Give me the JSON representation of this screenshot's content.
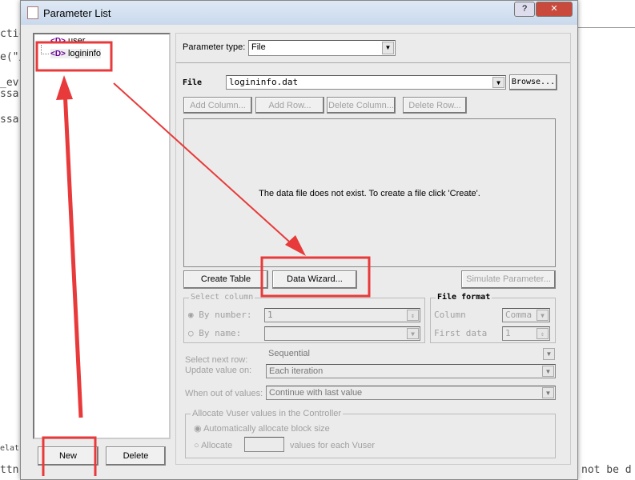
{
  "background": {
    "code": [
      "ctic",
      "e(\"/",
      "_ev",
      "ssa",
      "ssa",
      "elatio",
      "ttn"
    ],
    "right_text": "not be d"
  },
  "window": {
    "title": "Parameter List",
    "help": "?",
    "close": "✕"
  },
  "tree": {
    "items": [
      {
        "label": "user",
        "icon": "parameter-icon"
      },
      {
        "label": "logininfo",
        "icon": "parameter-icon"
      }
    ]
  },
  "left_buttons": {
    "new": "New",
    "delete": "Delete"
  },
  "param_type": {
    "label": "Parameter type:",
    "value": "File"
  },
  "file": {
    "label": "File",
    "value": "logininfo.dat",
    "browse": "Browse..."
  },
  "table_buttons": {
    "add_column": "Add Column...",
    "add_row": "Add Row...",
    "delete_column": "Delete Column...",
    "delete_row": "Delete Row..."
  },
  "message": "The data file does not exist. To create a file click 'Create'.",
  "actions": {
    "create_table": "Create Table",
    "data_wizard": "Data Wizard...",
    "simulate": "Simulate Parameter..."
  },
  "select_column": {
    "title": "Select column",
    "by_number": "By number:",
    "by_number_value": "1",
    "by_name": "By name:"
  },
  "file_format": {
    "title": "File format",
    "column_label": "Column",
    "column_value": "Comma",
    "first_data_label": "First data",
    "first_data_value": "1"
  },
  "select_next_row": {
    "label": "Select next row:",
    "value": "Sequential"
  },
  "update_value": {
    "label": "Update value on:",
    "value": "Each iteration"
  },
  "out_of_values": {
    "label": "When out of values:",
    "value": "Continue with last value"
  },
  "allocate": {
    "title": "Allocate Vuser values in the Controller",
    "auto": "Automatically allocate block size",
    "allocate": "Allocate",
    "suffix": "values for each Vuser"
  },
  "annotation_color": "#e83a3a"
}
